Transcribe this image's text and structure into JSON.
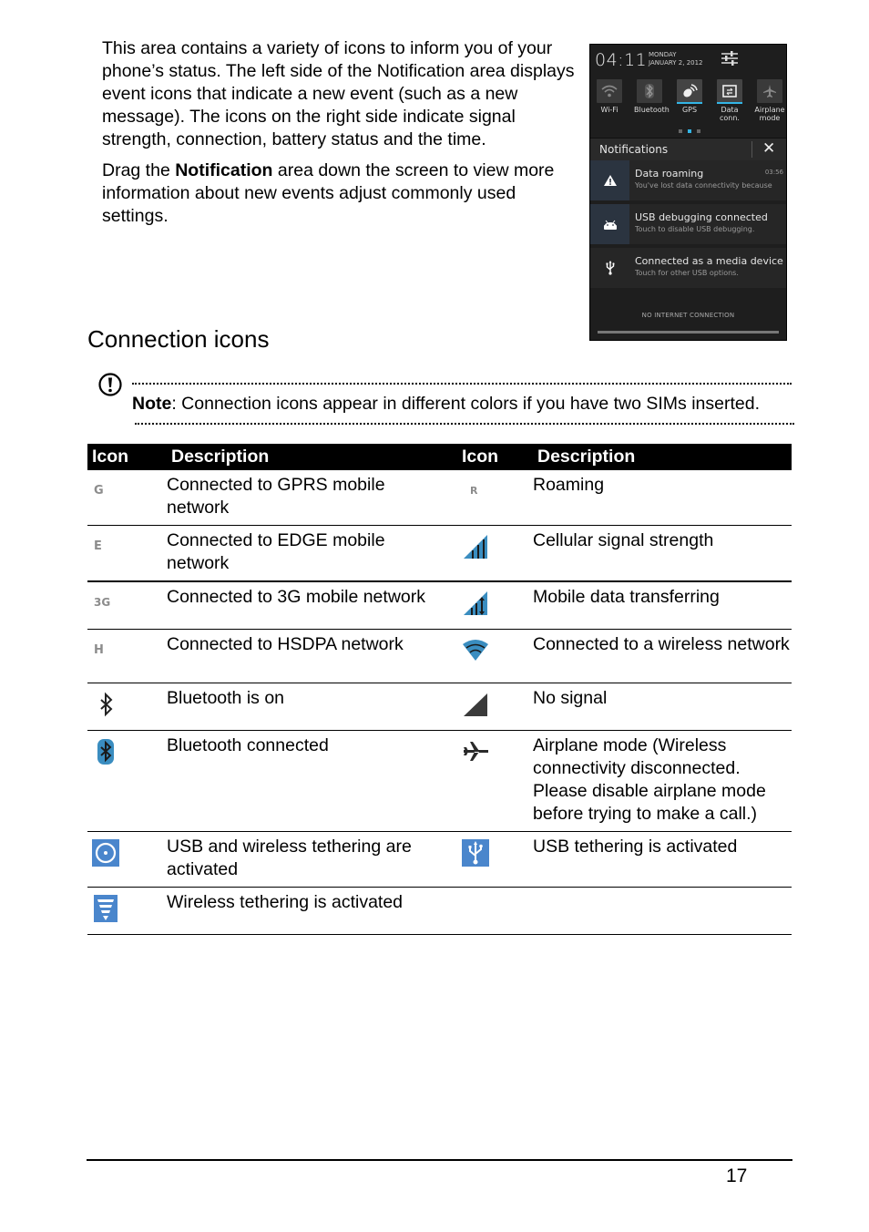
{
  "intro": {
    "paragraph1": "This area contains a variety of icons to inform you of your phone’s status. The left side of the Notification area displays event icons that indicate a new event (such as a new message). The icons on the right side indicate signal strength, connection, battery status and the time.",
    "paragraph2_prefix": "Drag the ",
    "paragraph2_bold": "Notification",
    "paragraph2_suffix": " area down the screen to view more information about new events adjust commonly used settings."
  },
  "phone_screen": {
    "time": "04:11",
    "day": "MONDAY",
    "date": "JANUARY 2, 2012",
    "toggles": [
      {
        "label": "Wi-Fi",
        "icon": "wifi-icon",
        "active": false
      },
      {
        "label": "Bluetooth",
        "icon": "bluetooth-icon",
        "active": false
      },
      {
        "label": "GPS",
        "icon": "gps-icon",
        "active": true
      },
      {
        "label": "Data conn.",
        "icon": "data-connection-icon",
        "active": true
      },
      {
        "label": "Airplane mode",
        "icon": "airplane-icon",
        "active": false
      }
    ],
    "page_dots": 3,
    "page_dots_active": 2,
    "notifications_title": "Notifications",
    "notifications": [
      {
        "title": "Data roaming",
        "subtitle": "You've lost data connectivity because",
        "time": "03:56",
        "icon": "warning-icon"
      },
      {
        "title": "USB debugging connected",
        "subtitle": "Touch to disable USB debugging.",
        "time": "",
        "icon": "android-icon"
      },
      {
        "title": "Connected as a media device",
        "subtitle": "Touch for other USB options.",
        "time": "",
        "icon": "usb-icon"
      }
    ],
    "footer": "NO INTERNET CONNECTION"
  },
  "section_title": "Connection icons",
  "note": {
    "label": "Note",
    "text": ": Connection icons appear in different colors if you have two SIMs inserted."
  },
  "table": {
    "headers": [
      "Icon",
      "Description",
      "Icon",
      "Description"
    ],
    "rows": [
      {
        "left_icon": "gprs-icon",
        "left_icon_text": "G",
        "left_desc": "Connected to GPRS mobile network",
        "right_icon": "roaming-icon",
        "right_icon_text": "R",
        "right_desc": "Roaming"
      },
      {
        "left_icon": "edge-icon",
        "left_icon_text": "E",
        "left_desc": "Connected to EDGE mobile network",
        "right_icon": "signal-strength-icon",
        "right_icon_text": "",
        "right_desc": "Cellular signal strength"
      },
      {
        "left_icon": "3g-icon",
        "left_icon_text": "3G",
        "left_desc": "Connected to 3G mobile network",
        "right_icon": "data-transfer-icon",
        "right_icon_text": "",
        "right_desc": "Mobile data transferring"
      },
      {
        "left_icon": "hsdpa-icon",
        "left_icon_text": "H",
        "left_desc": "Connected to HSDPA network",
        "right_icon": "wifi-icon",
        "right_icon_text": "",
        "right_desc": "Connected to a wireless network"
      },
      {
        "left_icon": "bluetooth-on-icon",
        "left_icon_text": "",
        "left_desc": "Bluetooth is on",
        "right_icon": "no-signal-icon",
        "right_icon_text": "",
        "right_desc": "No signal"
      },
      {
        "left_icon": "bluetooth-connected-icon",
        "left_icon_text": "",
        "left_desc": "Bluetooth connected",
        "right_icon": "airplane-icon",
        "right_icon_text": "",
        "right_desc": "Airplane mode (Wireless connectivity disconnected. Please disable airplane mode before trying to make a call.)"
      },
      {
        "left_icon": "usb-wireless-tethering-icon",
        "left_icon_text": "",
        "left_desc": "USB and wireless tethering are activated",
        "right_icon": "usb-tethering-icon",
        "right_icon_text": "",
        "right_desc": "USB tethering is activated"
      },
      {
        "left_icon": "wireless-tethering-icon",
        "left_icon_text": "",
        "left_desc": "Wireless tethering is activated",
        "right_icon": "",
        "right_icon_text": "",
        "right_desc": ""
      }
    ]
  },
  "colors": {
    "icon_blue": "#3a8dc0",
    "tether_blue": "#4a86cc",
    "holo_blue": "#33b5e5",
    "icon_gray": "#8c8c8c",
    "icon_dark": "#3a3a3a"
  },
  "page_number": "17"
}
